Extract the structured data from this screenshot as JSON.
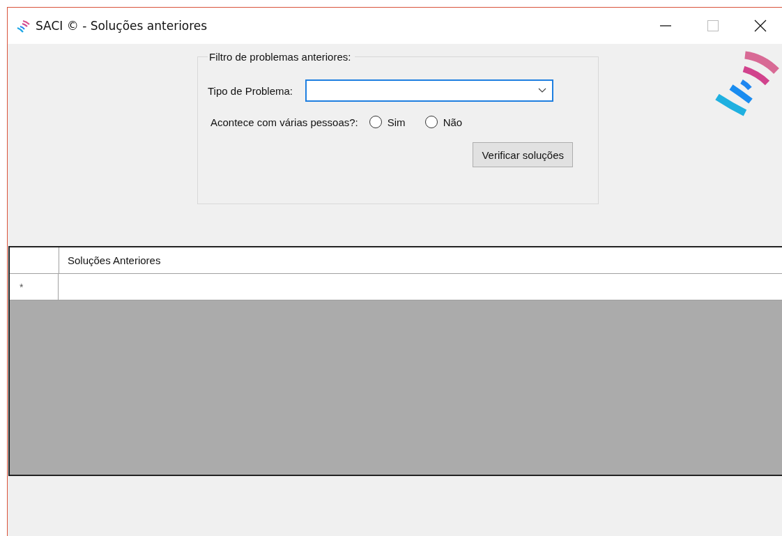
{
  "window": {
    "title": "SACI © - Soluções anteriores"
  },
  "filter": {
    "legend": "Filtro de problemas anteriores:",
    "problem_type": {
      "label": "Tipo de Problema:",
      "focused": true
    },
    "question": "Acontece com várias pessoas?:",
    "options": [
      {
        "label": "Sim",
        "selected": false
      },
      {
        "label": "Não",
        "selected": false
      }
    ],
    "button": "Verificar soluções"
  },
  "grid": {
    "columns": [
      "Soluções Anteriores"
    ],
    "new_row_mark": "*"
  }
}
